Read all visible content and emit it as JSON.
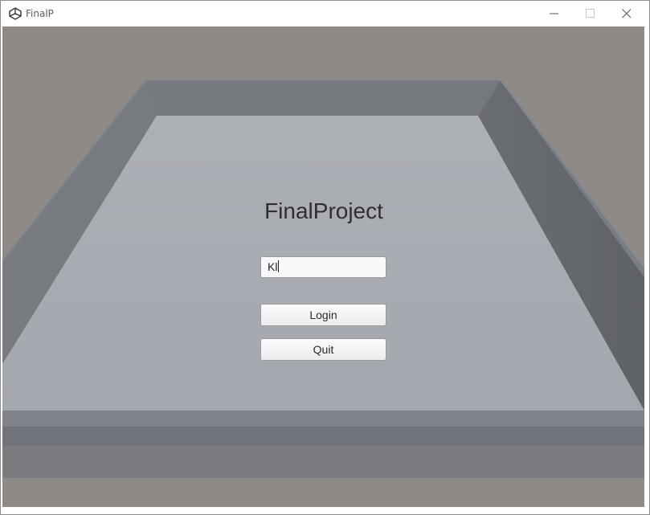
{
  "window": {
    "title": "FinalP",
    "icon": "unity-logo-icon",
    "controls": [
      "minimize-icon",
      "maximize-icon",
      "close-icon"
    ]
  },
  "menu": {
    "game_title": "FinalProject",
    "name_input_value": "Kl",
    "login_label": "Login",
    "quit_label": "Quit"
  },
  "colors": {
    "floor": "#a7aab0",
    "wall": "#6f7378",
    "background": "#8f8a85",
    "title_text": "#2f2f2f"
  }
}
